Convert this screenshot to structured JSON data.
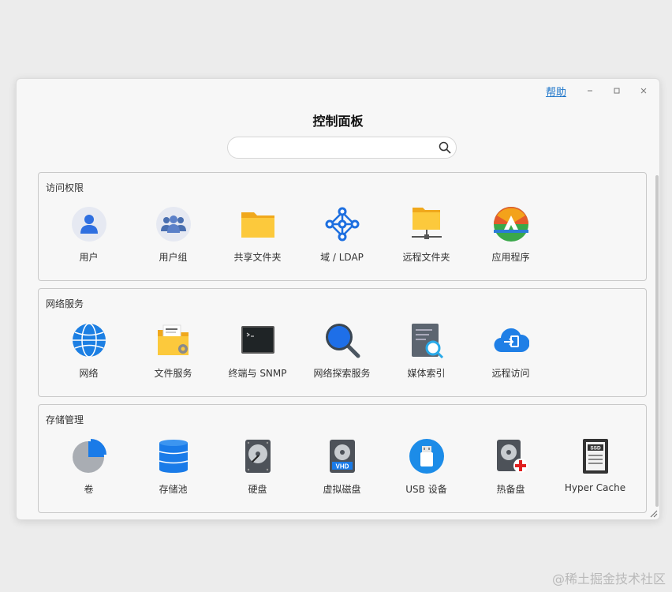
{
  "window": {
    "help_label": "帮助",
    "title": "控制面板"
  },
  "search": {
    "placeholder": "",
    "value": ""
  },
  "sections": [
    {
      "title": "访问权限",
      "items": [
        {
          "label": "用户",
          "icon": "user-icon"
        },
        {
          "label": "用户组",
          "icon": "user-group-icon"
        },
        {
          "label": "共享文件夹",
          "icon": "shared-folder-icon"
        },
        {
          "label": "域 / LDAP",
          "icon": "domain-ldap-icon"
        },
        {
          "label": "远程文件夹",
          "icon": "remote-folder-icon"
        },
        {
          "label": "应用程序",
          "icon": "app-icon"
        }
      ]
    },
    {
      "title": "网络服务",
      "items": [
        {
          "label": "网络",
          "icon": "globe-icon"
        },
        {
          "label": "文件服务",
          "icon": "file-service-icon"
        },
        {
          "label": "终端与 SNMP",
          "icon": "terminal-icon"
        },
        {
          "label": "网络探索服务",
          "icon": "discovery-icon"
        },
        {
          "label": "媒体索引",
          "icon": "media-index-icon"
        },
        {
          "label": "远程访问",
          "icon": "remote-access-icon"
        }
      ]
    },
    {
      "title": "存储管理",
      "items": [
        {
          "label": "卷",
          "icon": "volume-pie-icon"
        },
        {
          "label": "存储池",
          "icon": "storage-pool-icon"
        },
        {
          "label": "硬盘",
          "icon": "hard-disk-icon"
        },
        {
          "label": "虚拟磁盘",
          "icon": "virtual-disk-icon"
        },
        {
          "label": "USB 设备",
          "icon": "usb-icon"
        },
        {
          "label": "热备盘",
          "icon": "hot-spare-icon"
        },
        {
          "label": "Hyper Cache",
          "icon": "ssd-cache-icon"
        }
      ]
    }
  ],
  "hdd_badge": "VHD",
  "ssd_badge": "SSD",
  "watermark": "@稀土掘金技术社区"
}
